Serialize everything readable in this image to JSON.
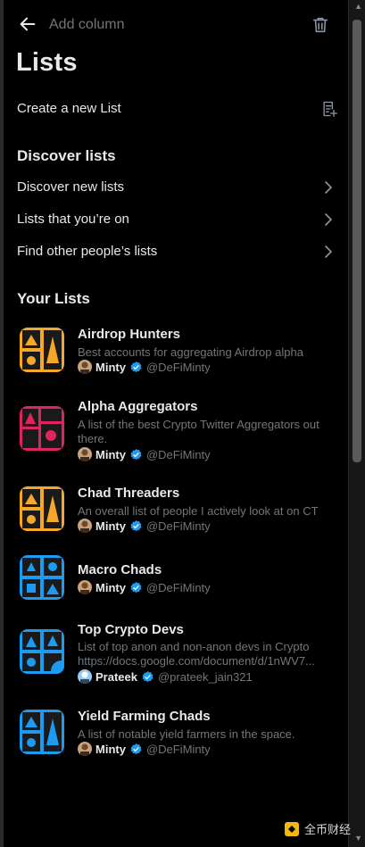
{
  "header": {
    "back_icon": "arrow-left-icon",
    "add_column_label": "Add column",
    "trash_icon": "trash-icon"
  },
  "page_title": "Lists",
  "create_list": {
    "label": "Create a new List",
    "icon": "new-list-icon"
  },
  "discover": {
    "title": "Discover lists",
    "items": [
      {
        "label": "Discover new lists"
      },
      {
        "label": "Lists that you’re on"
      },
      {
        "label": "Find other people’s lists"
      }
    ]
  },
  "your_lists": {
    "title": "Your Lists",
    "items": [
      {
        "name": "Airdrop Hunters",
        "desc": [
          "Best accounts for aggregating Airdrop alpha"
        ],
        "owner": "Minty",
        "handle": "@DeFiMinty",
        "theme_color": "#f7a82a"
      },
      {
        "name": "Alpha Aggregators",
        "desc": [
          "A list of the best Crypto Twitter Aggregators out",
          "there."
        ],
        "owner": "Minty",
        "handle": "@DeFiMinty",
        "theme_color": "#e0245e"
      },
      {
        "name": "Chad Threaders",
        "desc": [
          "An overall list of people I actively look at on CT"
        ],
        "owner": "Minty",
        "handle": "@DeFiMinty",
        "theme_color": "#f7a82a"
      },
      {
        "name": "Macro Chads",
        "desc": [],
        "owner": "Minty",
        "handle": "@DeFiMinty",
        "theme_color": "#1d9bf0"
      },
      {
        "name": "Top Crypto Devs",
        "desc": [
          "List of top anon and non-anon devs in Crypto",
          "https://docs.google.com/document/d/1nWV7..."
        ],
        "owner": "Prateek",
        "handle": "@prateek_jain321",
        "theme_color": "#1d9bf0"
      },
      {
        "name": "Yield Farming Chads",
        "desc": [
          "A list of notable yield farmers in the space."
        ],
        "owner": "Minty",
        "handle": "@DeFiMinty",
        "theme_color": "#1d9bf0"
      }
    ]
  },
  "watermark": {
    "text": "全币财经"
  },
  "colors": {
    "background": "#000000",
    "text_primary": "#e7e9ea",
    "text_secondary": "#71767b",
    "verified": "#1d9bf0"
  }
}
